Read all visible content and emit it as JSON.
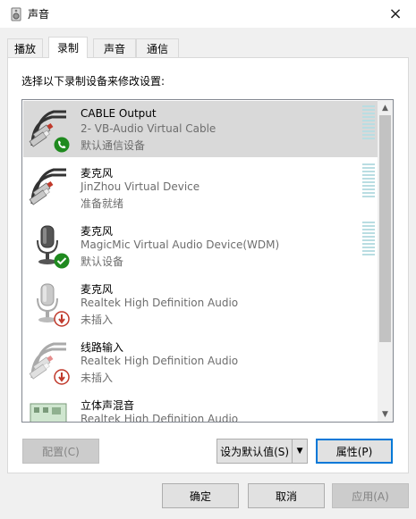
{
  "window": {
    "title": "声音",
    "close_icon": "×"
  },
  "tabs": [
    {
      "label": "播放"
    },
    {
      "label": "录制"
    },
    {
      "label": "声音"
    },
    {
      "label": "通信"
    }
  ],
  "panel": {
    "label": "选择以下录制设备来修改设置:"
  },
  "devices": [
    {
      "name": "CABLE Output",
      "desc": "2- VB-Audio Virtual Cable",
      "status": "默认通信设备",
      "icon": "rca-cable-icon",
      "badge": "phone-badge-icon"
    },
    {
      "name": "麦克风",
      "desc": "JinZhou Virtual Device",
      "status": "准备就绪",
      "icon": "rca-cable-icon",
      "badge": ""
    },
    {
      "name": "麦克风",
      "desc": "MagicMic Virtual Audio Device(WDM)",
      "status": "默认设备",
      "icon": "microphone-icon",
      "badge": "check-badge-icon"
    },
    {
      "name": "麦克风",
      "desc": "Realtek High Definition Audio",
      "status": "未插入",
      "icon": "microphone-icon",
      "badge": "unplugged-badge-icon"
    },
    {
      "name": "线路输入",
      "desc": "Realtek High Definition Audio",
      "status": "未插入",
      "icon": "rca-cable-icon",
      "badge": "unplugged-badge-icon"
    },
    {
      "name": "立体声混音",
      "desc": "Realtek High Definition Audio",
      "status": "",
      "icon": "sound-card-icon",
      "badge": ""
    }
  ],
  "buttons": {
    "configure": "配置(C)",
    "set_default": "设为默认值(S)",
    "properties": "属性(P)",
    "ok": "确定",
    "cancel": "取消",
    "apply": "应用(A)"
  }
}
